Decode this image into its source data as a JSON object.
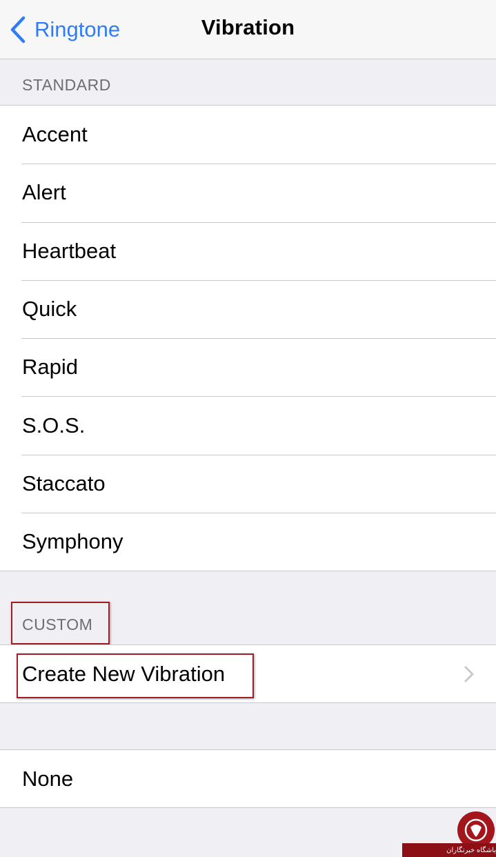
{
  "navbar": {
    "back_label": "Ringtone",
    "title": "Vibration",
    "accent_color": "#2f7cf6"
  },
  "standard": {
    "header": "STANDARD",
    "items": [
      {
        "label": "Accent"
      },
      {
        "label": "Alert"
      },
      {
        "label": "Heartbeat"
      },
      {
        "label": "Quick"
      },
      {
        "label": "Rapid"
      },
      {
        "label": "S.O.S."
      },
      {
        "label": "Staccato"
      },
      {
        "label": "Symphony"
      }
    ]
  },
  "custom": {
    "header": "CUSTOM",
    "create_label": "Create New Vibration",
    "chevron_icon": "chevron-right-icon"
  },
  "none_group": {
    "none_label": "None"
  },
  "annotation": {
    "highlight_color": "#a11d23"
  },
  "watermark": {
    "text": "باشگاه خبرنگاران",
    "logo_icon": "logo-icon"
  }
}
